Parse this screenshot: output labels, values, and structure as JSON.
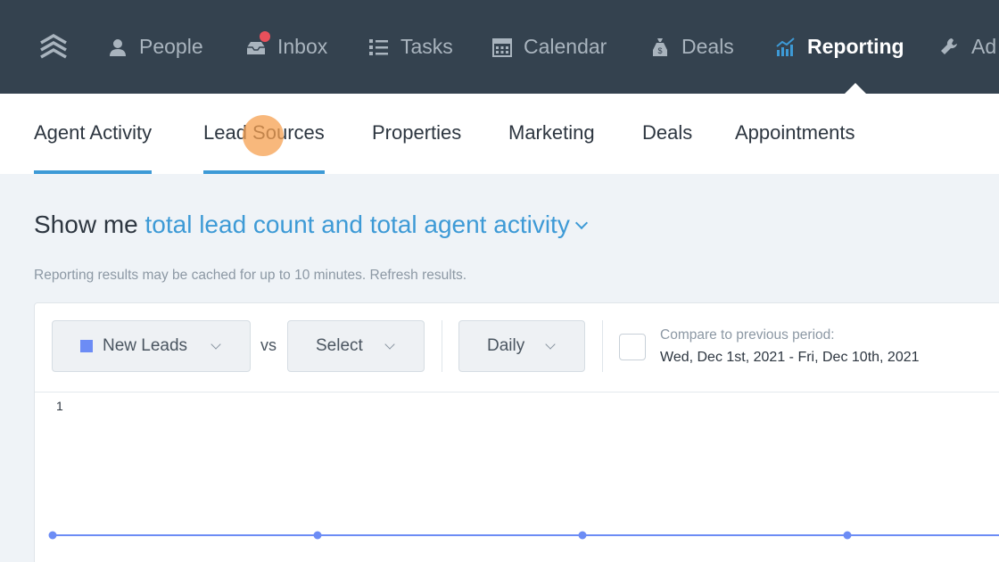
{
  "topnav": {
    "items": [
      {
        "label": "People",
        "icon": "person-icon"
      },
      {
        "label": "Inbox",
        "icon": "inbox-icon",
        "has_notification": true
      },
      {
        "label": "Tasks",
        "icon": "list-icon"
      },
      {
        "label": "Calendar",
        "icon": "calendar-icon"
      },
      {
        "label": "Deals",
        "icon": "money-bag-icon"
      },
      {
        "label": "Reporting",
        "icon": "chart-icon",
        "active": true
      },
      {
        "label": "Ad",
        "icon": "wrench-icon"
      }
    ],
    "colors": {
      "bg": "#34424f",
      "text": "#a9b4be",
      "active": "#ffffff",
      "badge": "#e8505b"
    }
  },
  "subtabs": [
    {
      "label": "Agent Activity"
    },
    {
      "label": "Lead Sources"
    },
    {
      "label": "Properties"
    },
    {
      "label": "Marketing"
    },
    {
      "label": "Deals"
    },
    {
      "label": "Appointments"
    }
  ],
  "showme": {
    "prefix": "Show me",
    "selection": "total lead count and total agent activity"
  },
  "cache_note": {
    "text": "Reporting results may be cached for up to 10 minutes.",
    "refresh": "Refresh results."
  },
  "controls": {
    "metric": "New Leads",
    "vs": "vs",
    "compare_metric": "Select",
    "interval": "Daily",
    "compare_label": "Compare to previous period:",
    "compare_dates": "Wed, Dec 1st, 2021 - Fri, Dec 10th, 2021"
  },
  "accent_color": "#3d9ad6",
  "series_color": "#6c8cf5",
  "chart_data": {
    "type": "line",
    "series": [
      {
        "name": "New Leads",
        "values": [
          0,
          0,
          0,
          0,
          0
        ]
      }
    ],
    "y_tick_labels": [
      "1"
    ],
    "ylim": [
      0,
      1
    ]
  }
}
